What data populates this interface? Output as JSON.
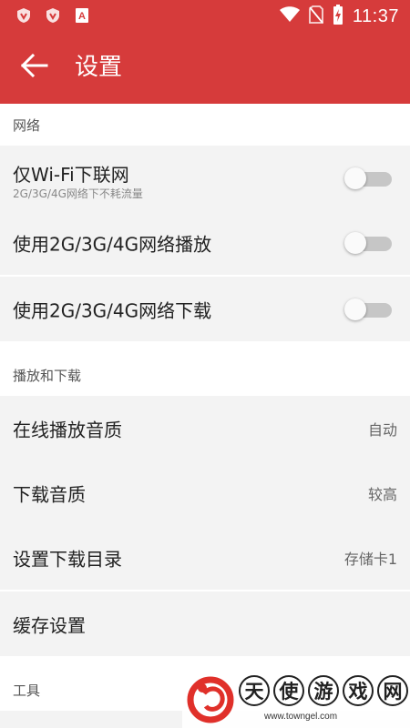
{
  "status_bar": {
    "time": "11:37",
    "left_icons": [
      "shield-icon",
      "shield-icon",
      "text-a-icon"
    ],
    "right_icons": [
      "wifi-icon",
      "no-sim-icon",
      "battery-charging-icon"
    ]
  },
  "app_bar": {
    "back_icon": "arrow-left-icon",
    "title": "设置"
  },
  "sections": {
    "network": {
      "header": "网络",
      "wifi_only": {
        "label": "仅Wi-Fi下联网",
        "sublabel": "2G/3G/4G网络下不耗流量",
        "on": false
      },
      "mobile_play": {
        "label": "使用2G/3G/4G网络播放",
        "on": false
      },
      "mobile_download": {
        "label": "使用2G/3G/4G网络下载",
        "on": false
      }
    },
    "playback": {
      "header": "播放和下载",
      "online_quality": {
        "label": "在线播放音质",
        "value": "自动"
      },
      "download_quality": {
        "label": "下载音质",
        "value": "较高"
      },
      "download_dir": {
        "label": "设置下载目录",
        "value": "存储卡1"
      },
      "cache": {
        "label": "缓存设置"
      }
    },
    "tools": {
      "header": "工具"
    }
  },
  "watermark": {
    "chars": [
      "天",
      "使",
      "游",
      "戏",
      "网"
    ],
    "url": "www.towngel.com"
  },
  "colors": {
    "accent": "#d63b3b",
    "toggle_off_track": "#c6c6c6"
  }
}
